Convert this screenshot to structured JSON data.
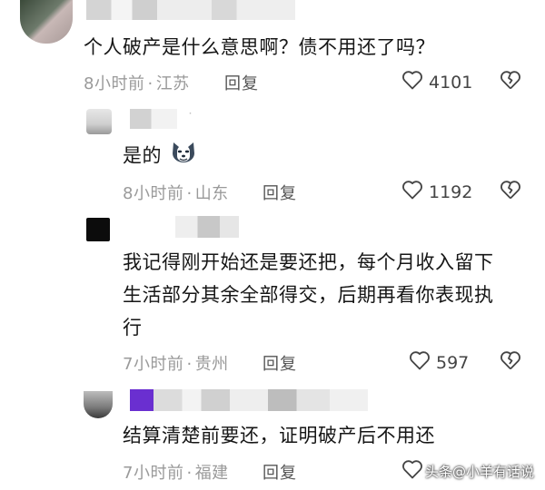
{
  "comments": [
    {
      "text": "个人破产是什么意思啊？债不用还了吗？",
      "time": "8小时前",
      "location": "江苏",
      "reply_label": "回复",
      "likes": "4101"
    },
    {
      "text": "是的",
      "time": "8小时前",
      "location": "山东",
      "reply_label": "回复",
      "likes": "1192"
    },
    {
      "text_line1": "我记得刚开始还是要还把，每个月收入留下",
      "text_line2": "生活部分其余全部得交，后期再看你表现执",
      "text_line3": "行",
      "time": "7小时前",
      "location": "贵州",
      "reply_label": "回复",
      "likes": "597"
    },
    {
      "text": "结算清楚前要还，证明破产后不用还",
      "time": "7小时前",
      "location": "福建",
      "reply_label": "回复"
    }
  ],
  "separator": "·",
  "watermark": "头条@小羊有话说",
  "icons": {
    "like": "heart-outline-icon",
    "dislike": "broken-heart-icon",
    "emoji": "husky-dog-emoji-icon"
  },
  "colors": {
    "text": "#161616",
    "meta": "#9a9a9a",
    "icon": "#444444"
  }
}
